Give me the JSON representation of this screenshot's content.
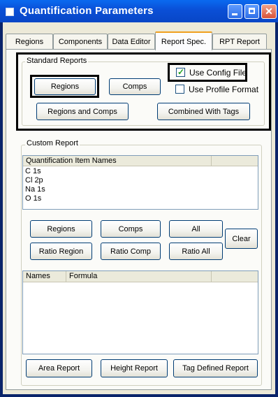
{
  "window": {
    "title": "Quantification Parameters"
  },
  "tabs": [
    {
      "label": "Regions"
    },
    {
      "label": "Components"
    },
    {
      "label": "Data Editor"
    },
    {
      "label": "Report Spec."
    },
    {
      "label": "RPT Report"
    }
  ],
  "standard_reports": {
    "legend": "Standard Reports",
    "regions_button": "Regions",
    "comps_button": "Comps",
    "regions_and_comps_button": "Regions and Comps",
    "combined_with_tags_button": "Combined With Tags",
    "use_config_file": {
      "label": "Use Config File",
      "checked": true
    },
    "use_profile_format": {
      "label": "Use Profile Format",
      "checked": false
    }
  },
  "custom_report": {
    "legend": "Custom Report",
    "items_list": {
      "header": "Quantification Item Names",
      "items": [
        "C 1s",
        "Cl 2p",
        "Na 1s",
        "O 1s"
      ]
    },
    "buttons": {
      "regions": "Regions",
      "comps": "Comps",
      "all": "All",
      "ratio_region": "Ratio Region",
      "ratio_comp": "Ratio Comp",
      "ratio_all": "Ratio All",
      "clear": "Clear"
    },
    "formula_list": {
      "headers": [
        "Names",
        "Formula"
      ]
    },
    "report_buttons": {
      "area": "Area Report",
      "height": "Height Report",
      "tag_defined": "Tag Defined Report"
    }
  }
}
